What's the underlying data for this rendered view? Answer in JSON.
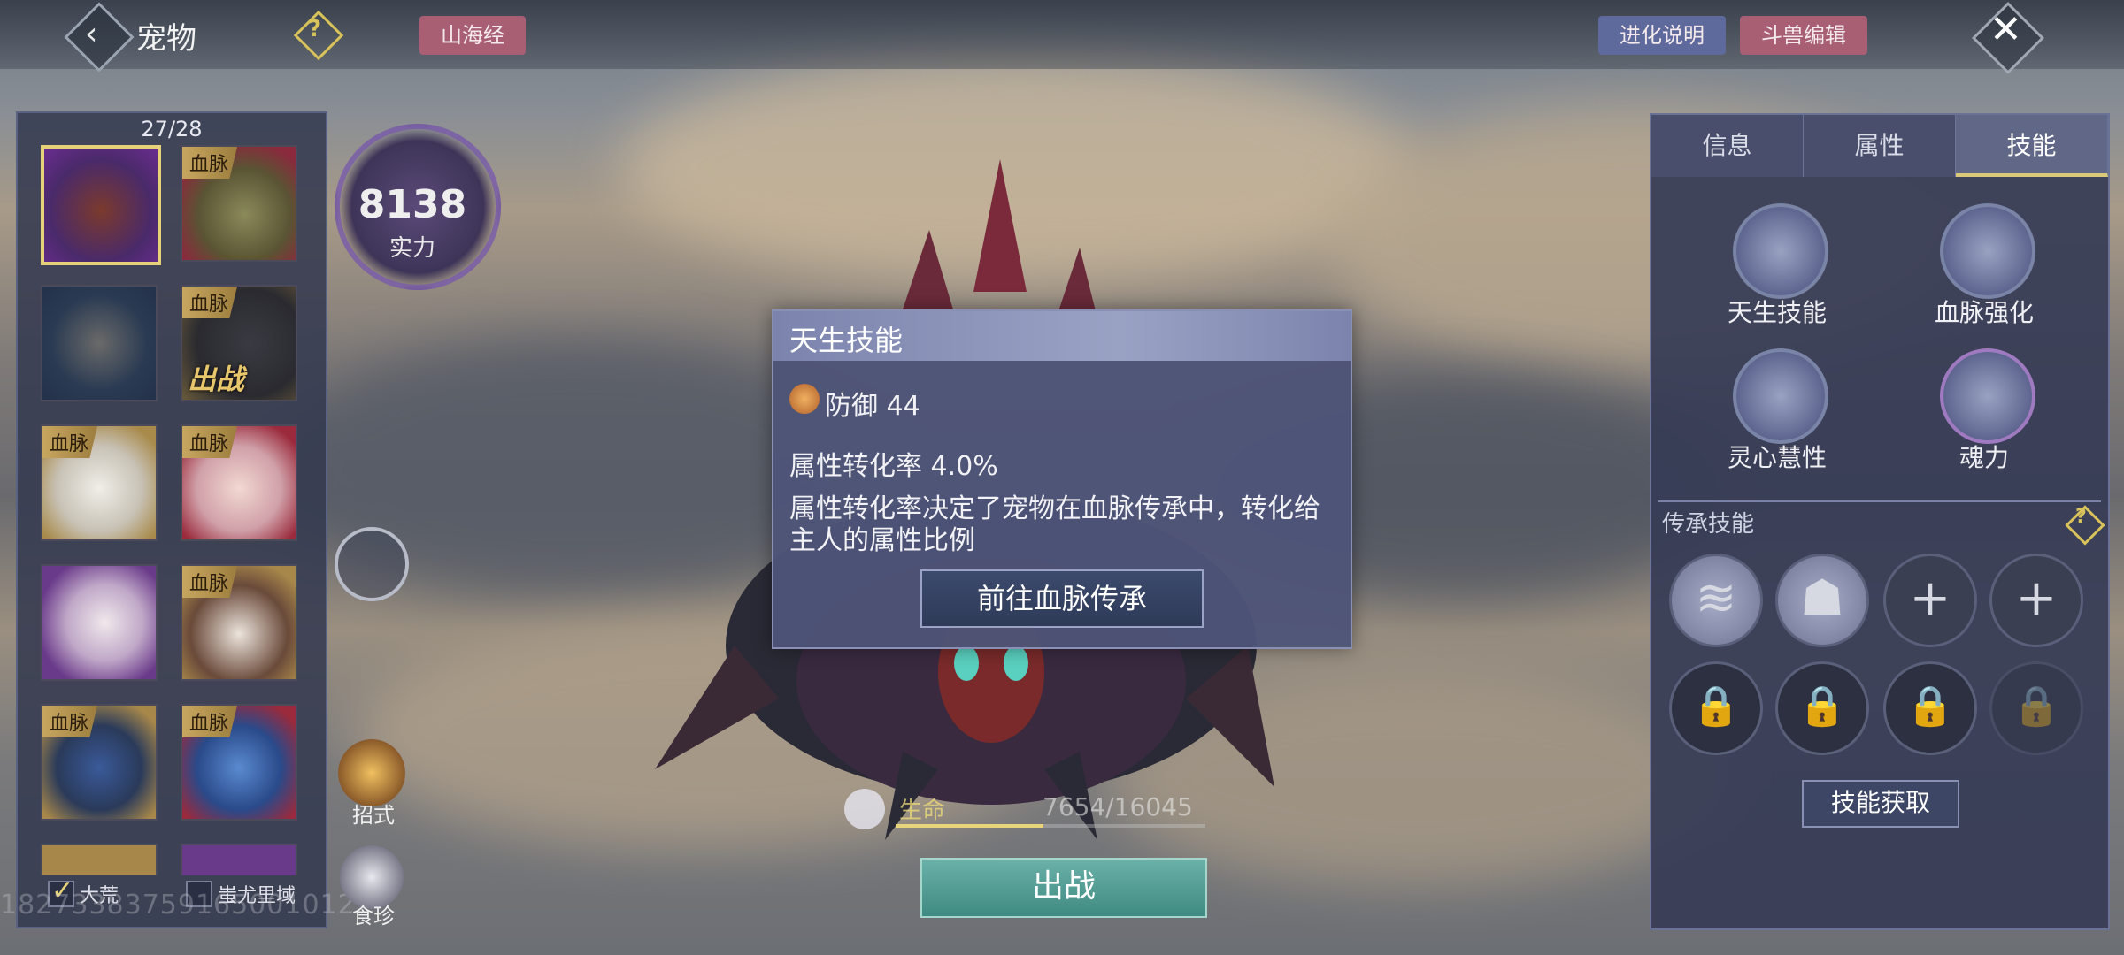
{
  "header": {
    "title": "宠物",
    "shanhai_label": "山海经",
    "evolve_label": "进化说明",
    "beast_edit_label": "斗兽编辑"
  },
  "pets": {
    "count": "27/28",
    "bloodline_tag": "血脉",
    "deployed_tag": "出战",
    "filters": [
      {
        "label": "大荒",
        "checked": true
      },
      {
        "label": "蚩尤里域",
        "checked": false
      }
    ]
  },
  "power": {
    "value": "8138",
    "label": "实力"
  },
  "side": {
    "moves_label": "招式",
    "food_label": "食珍"
  },
  "popup": {
    "title": "天生技能",
    "defense": "防御 44",
    "rate": "属性转化率 4.0%",
    "desc": "属性转化率决定了宠物在血脉传承中，转化给主人的属性比例",
    "button": "前往血脉传承"
  },
  "hp": {
    "label": "生命",
    "value": "7654/16045",
    "fraction": 0.477
  },
  "fight_label": "出战",
  "right": {
    "tabs": [
      "信息",
      "属性",
      "技能"
    ],
    "active_tab": 2,
    "skills": [
      "天生技能",
      "血脉强化",
      "灵心慧性",
      "魂力"
    ],
    "inherit_title": "传承技能",
    "acquire_label": "技能获取"
  },
  "watermark": "18273383759165001012",
  "colors": {
    "accent_gold": "#e7d27a",
    "fight_green": "#5aa89f",
    "tag_pink": "#a85f73",
    "tag_blue": "#5e6a9c"
  }
}
